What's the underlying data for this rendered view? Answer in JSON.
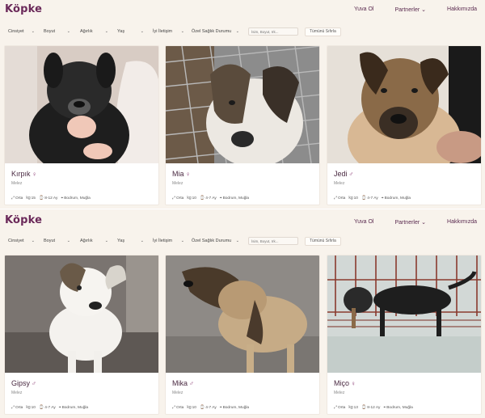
{
  "brand": {
    "logo": "Köpke"
  },
  "nav": {
    "adopt": "Yuva Ol",
    "partners": "Partnerler",
    "about": "Hakkımızda"
  },
  "filters": {
    "items": [
      "Cinsiyet",
      "Boyut",
      "Ağırlık",
      "Yaş",
      "İyi İletişim",
      "Özel Sağlık Durumu"
    ],
    "search_placeholder": "İsim, Boyut, Irk...",
    "reset_label": "Tümünü Sıfırla"
  },
  "sections": [
    {
      "dogs": [
        {
          "name": "Kırpık",
          "sex": "♀",
          "breed": "Melez",
          "size": "Orta",
          "weight": "15",
          "age": "8-12 Ay",
          "location": "Bodrum, Muğla"
        },
        {
          "name": "Mia",
          "sex": "♀",
          "breed": "Melez",
          "size": "Orta",
          "weight": "10",
          "age": "4-7 Ay",
          "location": "Bodrum, Muğla"
        },
        {
          "name": "Jedi",
          "sex": "♂",
          "breed": "Melez",
          "size": "Orta",
          "weight": "10",
          "age": "4-7 Ay",
          "location": "Bodrum, Muğla"
        }
      ]
    },
    {
      "dogs": [
        {
          "name": "Gipsy",
          "sex": "♂",
          "breed": "Melez",
          "size": "Orta",
          "weight": "10",
          "age": "4-7 Ay",
          "location": "Bodrum, Muğla"
        },
        {
          "name": "Mika",
          "sex": "♂",
          "breed": "Melez",
          "size": "Orta",
          "weight": "10",
          "age": "4-7 Ay",
          "location": "Bodrum, Muğla"
        },
        {
          "name": "Miço",
          "sex": "♀",
          "breed": "Melez",
          "size": "Orta",
          "weight": "13",
          "age": "8-12 Ay",
          "location": "Bodrum, Muğla"
        }
      ]
    }
  ]
}
